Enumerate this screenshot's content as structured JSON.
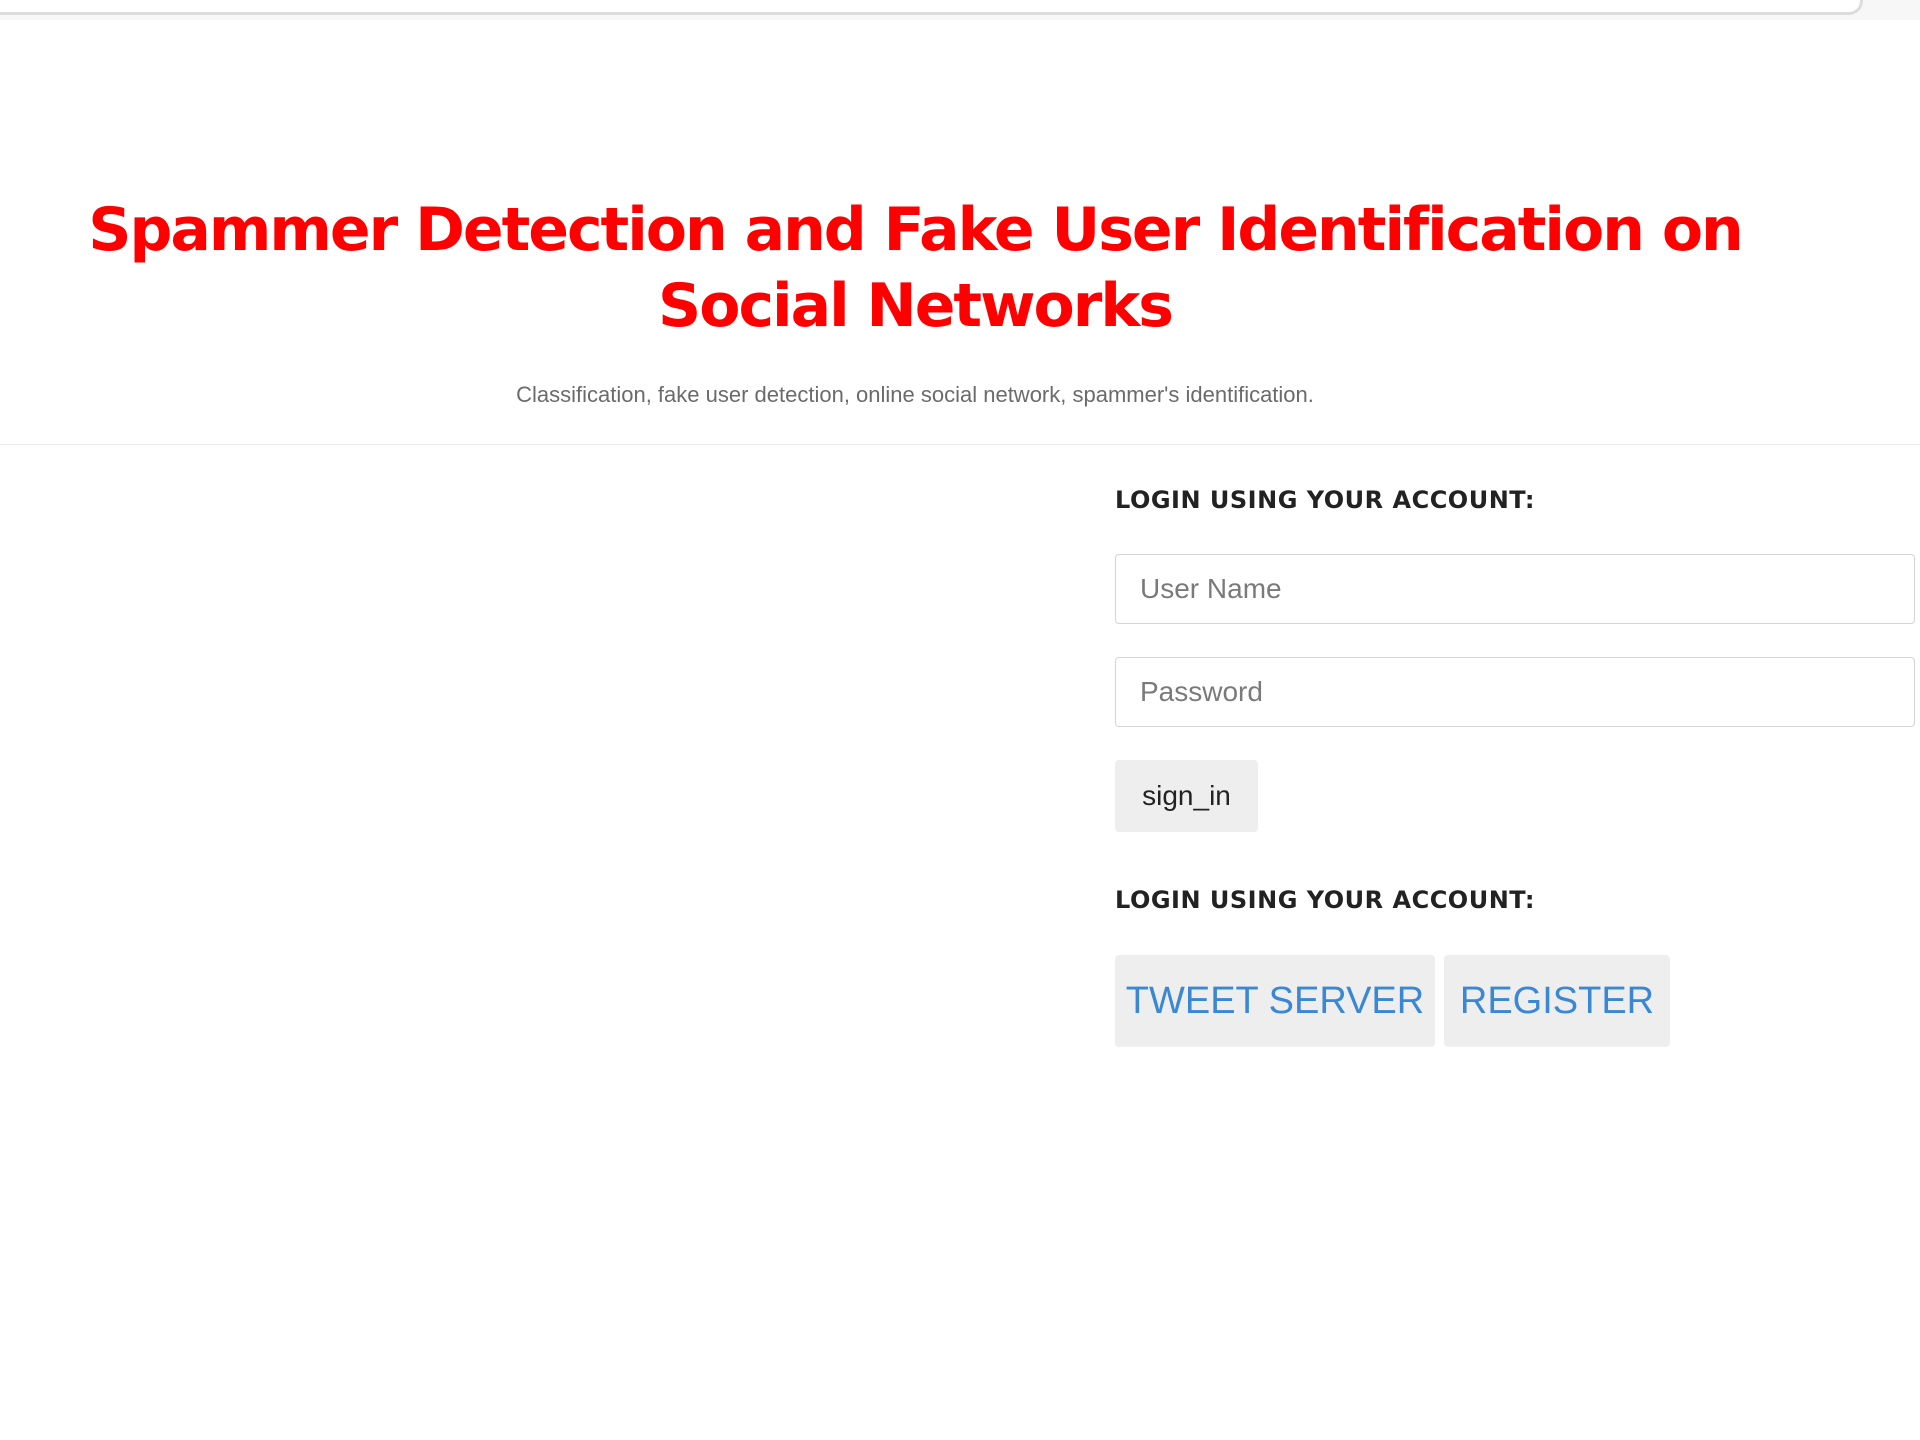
{
  "header": {
    "title": "Spammer Detection and Fake User Identification on Social Networks",
    "subtitle": "Classification, fake user detection, online social network, spammer's identification."
  },
  "login_form": {
    "heading": "LOGIN USING YOUR ACCOUNT:",
    "username_placeholder": "User Name",
    "password_placeholder": "Password",
    "sign_in_label": "sign_in"
  },
  "links_section": {
    "heading": "LOGIN USING YOUR ACCOUNT:",
    "tweet_server_label": "TWEET SERVER",
    "register_label": "REGISTER"
  },
  "colors": {
    "title": "#ff0000",
    "link_button_text": "#3a87d4",
    "button_background": "#eeeeee"
  }
}
